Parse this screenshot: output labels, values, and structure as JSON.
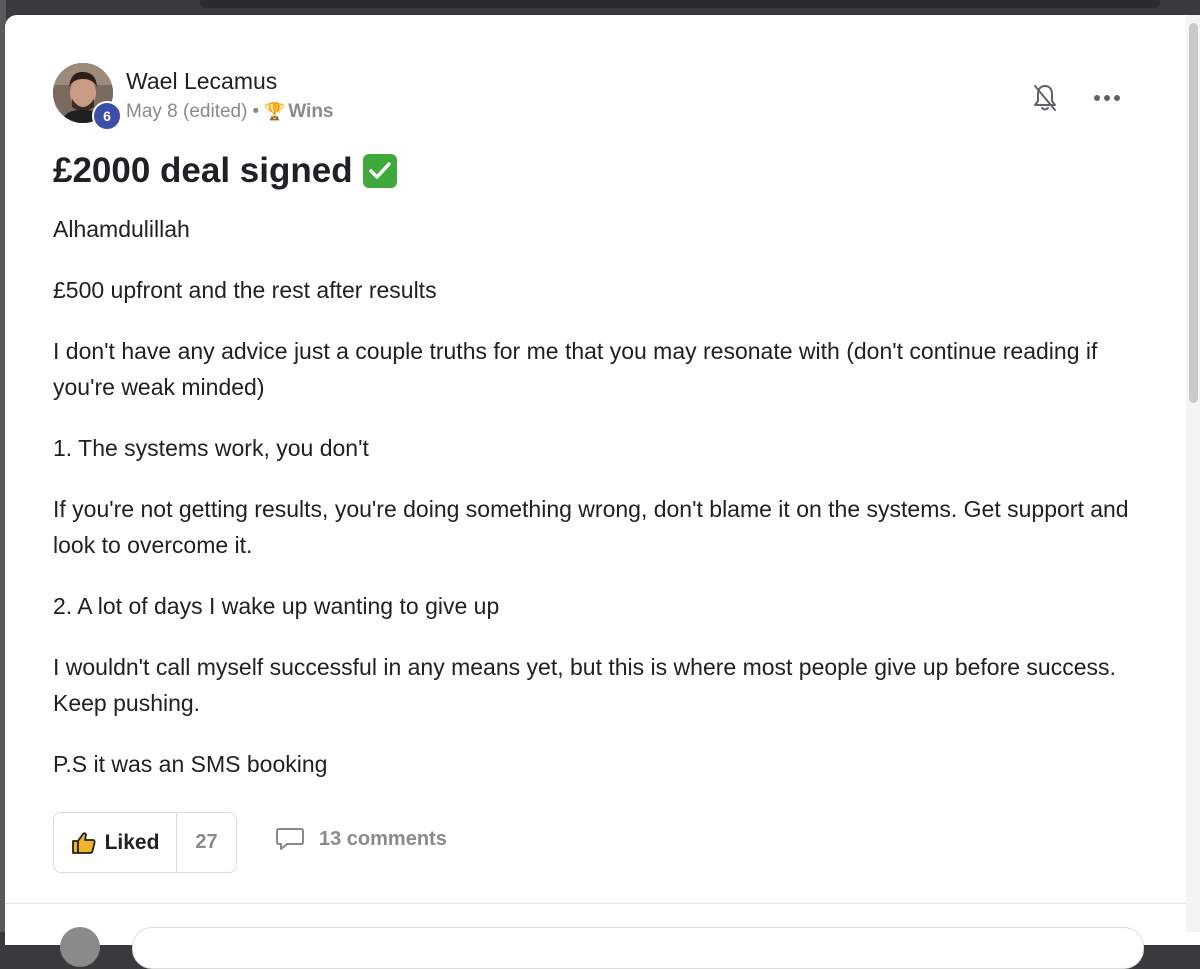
{
  "post": {
    "author": {
      "name": "Wael Lecamus",
      "level": "6"
    },
    "meta": {
      "date": "May 8 (edited)",
      "separator": "•",
      "category_icon": "trophy-icon",
      "category": "Wins"
    },
    "title": "£2000 deal signed",
    "title_emoji": "check-mark-button",
    "paragraphs": [
      "Alhamdulillah",
      "£500 upfront and the rest after results",
      "I don't have any advice just a couple truths for me that you may resonate with (don't continue reading if you're weak minded)",
      "1. The systems work, you don't",
      "If you're not getting results, you're doing something wrong, don't blame it on the systems. Get support and look to overcome it.",
      "2. A lot of days I wake up wanting to give up",
      "I wouldn't call myself successful in any means yet, but this is where most people give up before success. Keep pushing.",
      "P.S it was an SMS booking"
    ],
    "actions": {
      "like_label": "Liked",
      "like_count": "27",
      "comments_label": "13 comments"
    }
  },
  "icons": {
    "bell": "bell-off-icon",
    "more": "more-horizontal-icon",
    "like": "thumbs-up-icon",
    "comment": "comment-bubble-icon"
  },
  "colors": {
    "level_badge": "#3b4fa8",
    "check_emoji": "#3eaa3b",
    "like_icon": "#f0b429",
    "muted_text": "#8a8a8a"
  }
}
